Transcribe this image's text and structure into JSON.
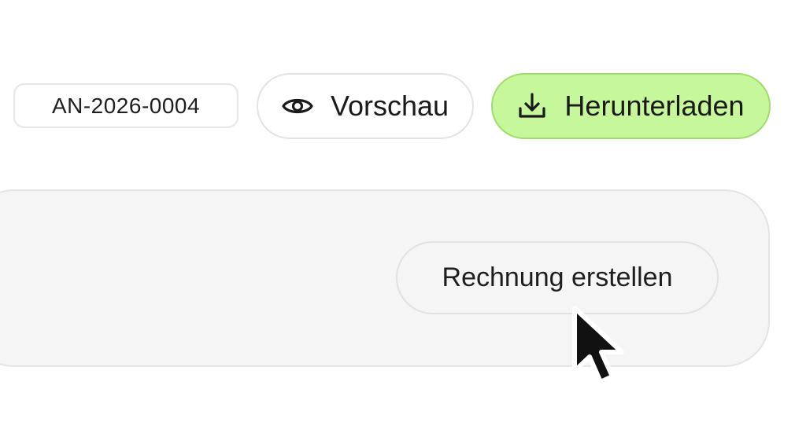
{
  "toolbar": {
    "document_number": "AN-2026-0004",
    "preview_label": "Vorschau",
    "download_label": "Herunterladen"
  },
  "panel": {
    "create_invoice_label": "Rechnung erstellen"
  },
  "icons": {
    "preview": "eye-icon",
    "download": "download-icon",
    "cursor": "mouse-pointer-icon"
  },
  "colors": {
    "download_bg": "#c6f79b",
    "download_border": "#9fdc6a",
    "panel_bg": "#f5f5f5"
  }
}
